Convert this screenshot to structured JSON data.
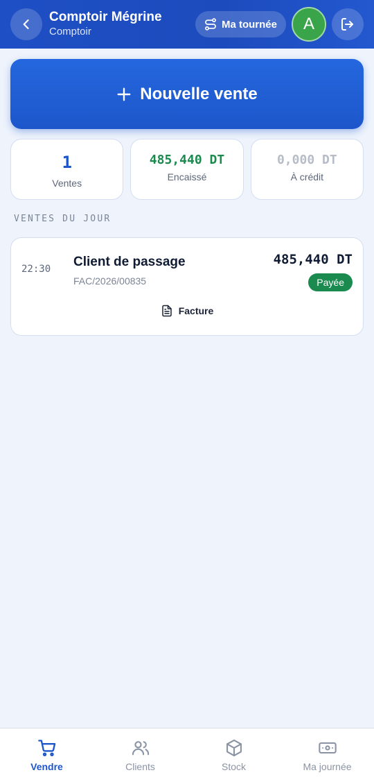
{
  "header": {
    "title": "Comptoir Mégrine",
    "subtitle": "Comptoir",
    "tour_label": "Ma tournée",
    "avatar_letter": "A"
  },
  "new_sale": {
    "label": "Nouvelle vente"
  },
  "stats": [
    {
      "value": "1",
      "label": "Ventes",
      "color": "#1d56cb"
    },
    {
      "value": "485,440 DT",
      "label": "Encaissé",
      "color": "#1a8a4e"
    },
    {
      "value": "0,000 DT",
      "label": "À crédit",
      "color": "#b6bcc8"
    }
  ],
  "section": {
    "title": "VENTES DU JOUR"
  },
  "sales": [
    {
      "time": "22:30",
      "client": "Client de passage",
      "reference": "FAC/2026/00835",
      "amount": "485,440 DT",
      "status": "Payée",
      "invoice_label": "Facture"
    }
  ],
  "nav": [
    {
      "label": "Vendre",
      "icon": "cart-icon",
      "active": true
    },
    {
      "label": "Clients",
      "icon": "users-icon",
      "active": false
    },
    {
      "label": "Stock",
      "icon": "box-icon",
      "active": false
    },
    {
      "label": "Ma journée",
      "icon": "banknote-icon",
      "active": false
    }
  ],
  "colors": {
    "primary": "#1d56cb",
    "success": "#1a8a4e",
    "background": "#eef3fc"
  }
}
